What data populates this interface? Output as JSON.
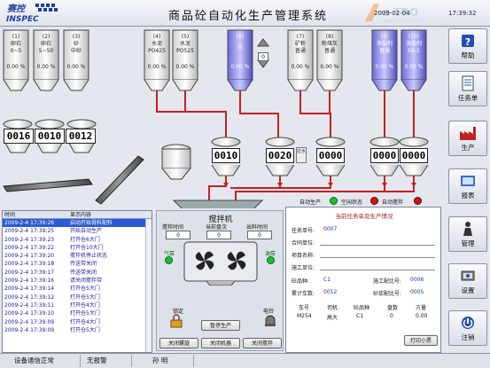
{
  "header": {
    "logo_line1": "赛控",
    "logo_line2": "INSPEC",
    "title": "商品砼自动化生产管理系统",
    "date": "2009-02-04",
    "time": "17:39:32",
    "watermark_url": "WWW.CNTRONICS.COM"
  },
  "menu": [
    {
      "label": "帮助",
      "icon": "help-icon"
    },
    {
      "label": "任务单",
      "icon": "task-icon"
    },
    {
      "label": "生产",
      "icon": "production-icon"
    },
    {
      "label": "报表",
      "icon": "report-icon"
    },
    {
      "label": "管理",
      "icon": "manage-icon"
    },
    {
      "label": "设置",
      "icon": "settings-icon"
    },
    {
      "label": "注销",
      "icon": "logout-icon"
    }
  ],
  "aggregate_silos": [
    {
      "num": "(1)",
      "name": "卵石",
      "spec": "0~5",
      "value": "0.00 %"
    },
    {
      "num": "(2)",
      "name": "卵石",
      "spec": "5~50",
      "value": "0.00 %"
    },
    {
      "num": "(3)",
      "name": "砂",
      "spec": "中砂",
      "value": "0.00 %"
    }
  ],
  "cement_silos": [
    {
      "num": "(4)",
      "name": "水泥",
      "spec": "PO425",
      "value": "0.00 %"
    },
    {
      "num": "(5)",
      "name": "水泥",
      "spec": "PO525",
      "value": "0.00 %"
    }
  ],
  "water_silo": {
    "num": "(6)",
    "name": "水",
    "value": "0.00 %"
  },
  "water_counter": "0",
  "powder_silos": [
    {
      "num": "(7)",
      "name": "矿粉",
      "spec": "普通",
      "value": "0.00 %"
    },
    {
      "num": "(8)",
      "name": "粉煤灰",
      "spec": "普通",
      "value": "0.00 %"
    }
  ],
  "additive_silos": [
    {
      "num": "(9)",
      "name": "添加剂",
      "spec": "普通",
      "value": "0.00 %"
    },
    {
      "num": "(10)",
      "name": "添加剂",
      "spec": "EA-1",
      "value": "0.00 %"
    }
  ],
  "aggregate_bins": [
    "0016",
    "0010",
    "0012"
  ],
  "weigh_cement": "0010",
  "weigh_water": "0020",
  "weigh_water_tag": "拉水",
  "weigh_powder": "0000",
  "weigh_add1": "0000",
  "weigh_add2": "0000",
  "status_lights": {
    "auto": "自动生产",
    "idle": "空闲状态",
    "stir": "自动搅拌"
  },
  "log": {
    "col_time": "时间",
    "col_msg": "显示内容",
    "rows": [
      {
        "t": "2009-2-4 17:39:26",
        "m": "启动开始骨料配料"
      },
      {
        "t": "2009-2-4 17:39:25",
        "m": "开始自动生产"
      },
      {
        "t": "2009-2-4 17:39:23",
        "m": "打开仓6大门"
      },
      {
        "t": "2009-2-4 17:39:22",
        "m": "打开仓10大门"
      },
      {
        "t": "2009-2-4 17:39:20",
        "m": "搅拌机停止状态"
      },
      {
        "t": "2009-2-4 17:39:18",
        "m": "传送带关闭"
      },
      {
        "t": "2009-2-4 17:39:17",
        "m": "传送带关闭"
      },
      {
        "t": "2009-2-4 17:39:16",
        "m": "请关闭搅拌带"
      },
      {
        "t": "2009-2-4 17:39:14",
        "m": "打开仓5大门"
      },
      {
        "t": "2009-2-4 17:39:12",
        "m": "打开仓5大门"
      },
      {
        "t": "2009-2-4 17:39:11",
        "m": "打开仓4大门"
      },
      {
        "t": "2009-2-4 17:39:10",
        "m": "打开仓5大门"
      },
      {
        "t": "2009-2-4 17:39:09",
        "m": "打开仓4大门"
      },
      {
        "t": "2009-2-4 17:39:09",
        "m": "打开仓5大门"
      }
    ]
  },
  "mixer": {
    "title": "搅拌机",
    "stir_time_label": "搅拌时间",
    "stir_time": "0",
    "current_plate_label": "当前盘次",
    "current_plate": "0",
    "discharge_time_label": "出料时间",
    "discharge_time": "0",
    "pump_left": "气泵",
    "pump_right": "油泵",
    "lock_label": "锁定",
    "motor_label": "电铃",
    "pause_button": "暂停生产",
    "button_a": "关闭螺旋",
    "button_b": "关闭机器",
    "button_c": "关闭搅拌"
  },
  "task_info": {
    "title": "当前任务单及生产情况",
    "task_no_label": "任务单号:",
    "task_no": "0007",
    "contract_label": "合同单位:",
    "project_label": "项目名称:",
    "construct_label": "施工单位:",
    "grade_label": "砼品种:",
    "grade": "C1",
    "mix_no_label": "施工配比号:",
    "mix_no": "0006",
    "total_label": "累计车数:",
    "total": "0012",
    "mortar_label": "砂浆配比号:",
    "mortar": "0005",
    "cols": [
      "车号",
      "司机",
      "砼品种",
      "盘数",
      "方量"
    ],
    "vals": [
      "M254",
      "高大",
      "C1",
      "0",
      "0.00"
    ],
    "print_button": "打印小票"
  },
  "status": {
    "comm": "设备通信正常",
    "alarm": "无报警",
    "user": "孙  明"
  }
}
